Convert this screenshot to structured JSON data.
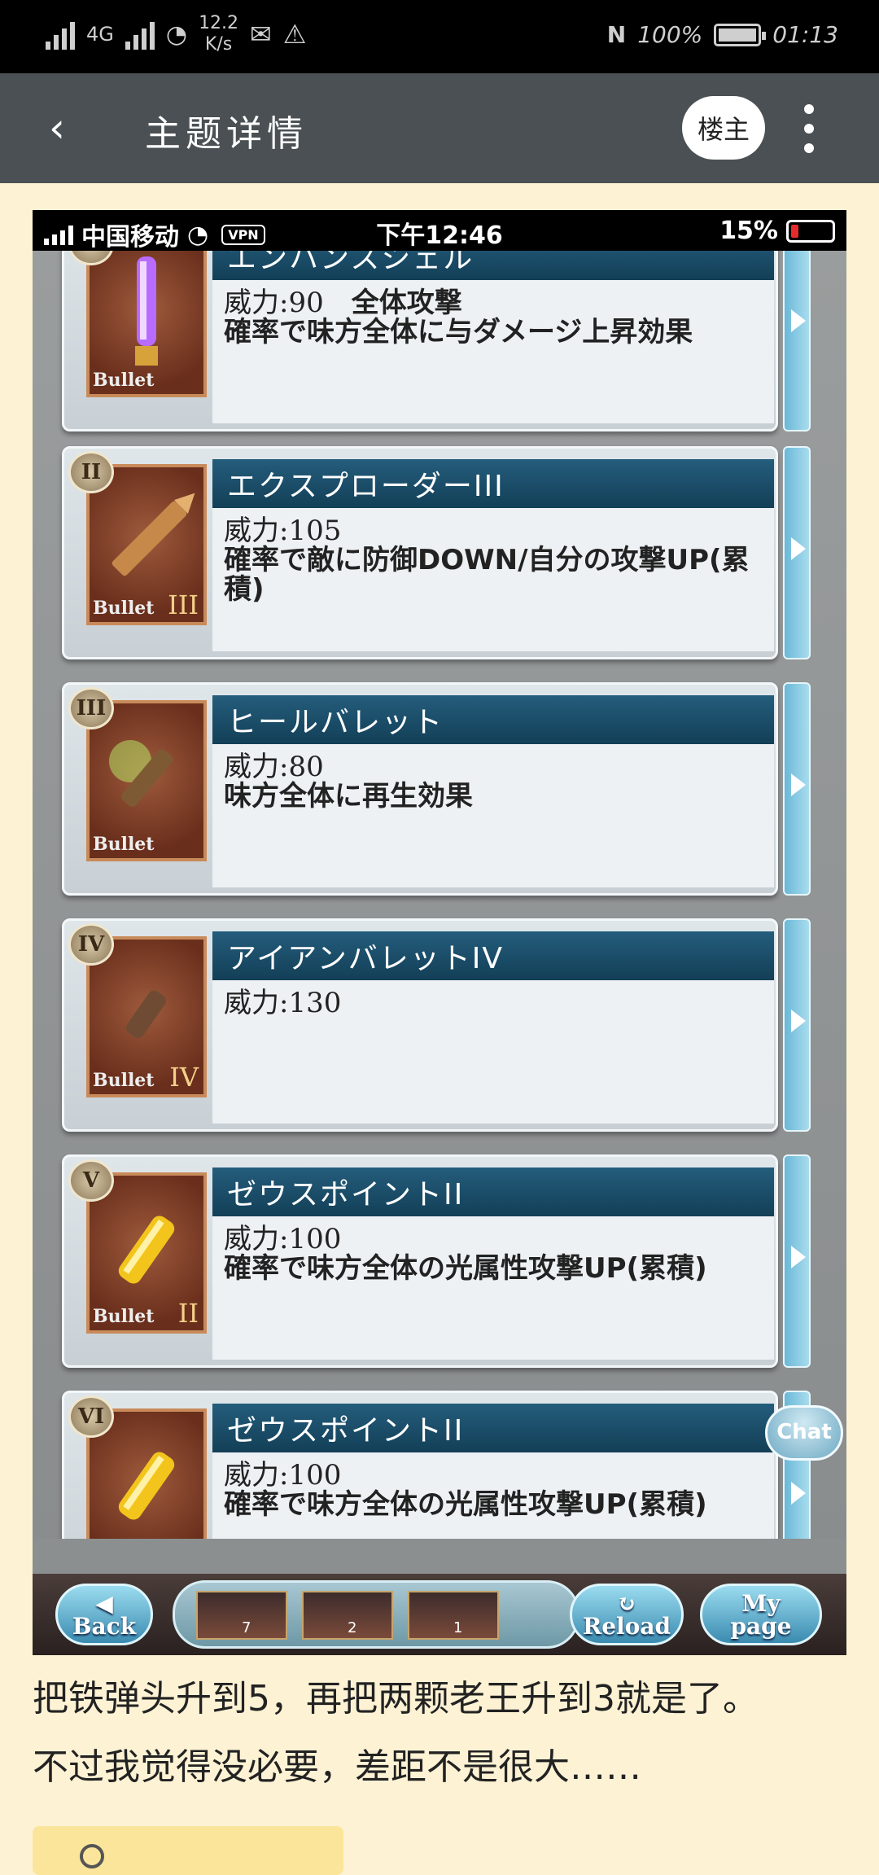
{
  "system_status": {
    "network_left": "4G",
    "speed_value": "12.2",
    "speed_unit": "K/s",
    "battery_percent": "100%",
    "time": "01:13"
  },
  "header": {
    "title": "主题详情",
    "op_badge": "楼主"
  },
  "game_screenshot": {
    "status": {
      "carrier": "中国移动",
      "vpn": "VPN",
      "time": "下午12:46",
      "battery": "15%"
    },
    "items": [
      {
        "numeral": "I",
        "name": "エンハンスシェル",
        "power": "威力:90",
        "extra": "全体攻撃",
        "effect": "確率で味方全体に与ダメージ上昇効果",
        "thumb_label": "Bullet",
        "level": ""
      },
      {
        "numeral": "II",
        "name": "エクスプローダーIII",
        "power": "威力:105",
        "extra": "",
        "effect": "確率で敵に防御DOWN/自分の攻撃UP(累積)",
        "thumb_label": "Bullet",
        "level": "III"
      },
      {
        "numeral": "III",
        "name": "ヒールバレット",
        "power": "威力:80",
        "extra": "",
        "effect": "味方全体に再生効果",
        "thumb_label": "Bullet",
        "level": ""
      },
      {
        "numeral": "IV",
        "name": "アイアンバレットIV",
        "power": "威力:130",
        "extra": "",
        "effect": "",
        "thumb_label": "Bullet",
        "level": "IV"
      },
      {
        "numeral": "V",
        "name": "ゼウスポイントII",
        "power": "威力:100",
        "extra": "",
        "effect": "確率で味方全体の光属性攻撃UP(累積)",
        "thumb_label": "Bullet",
        "level": "II"
      },
      {
        "numeral": "VI",
        "name": "ゼウスポイントII",
        "power": "威力:100",
        "extra": "",
        "effect": "確率で味方全体の光属性攻撃UP(累積)",
        "thumb_label": "",
        "level": ""
      }
    ],
    "chat_label": "Chat",
    "bottom": {
      "back_line1": "◀",
      "back_line2": "Back",
      "reload_line1": "↻",
      "reload_line2": "Reload",
      "mypage_line1": "My",
      "mypage_line2": "page",
      "counts": [
        "7",
        "2",
        "1"
      ]
    }
  },
  "post": {
    "line1": "把铁弹头升到5，再把两颗老王升到3就是了。",
    "line2": "不过我觉得没必要，差距不是很大……"
  }
}
